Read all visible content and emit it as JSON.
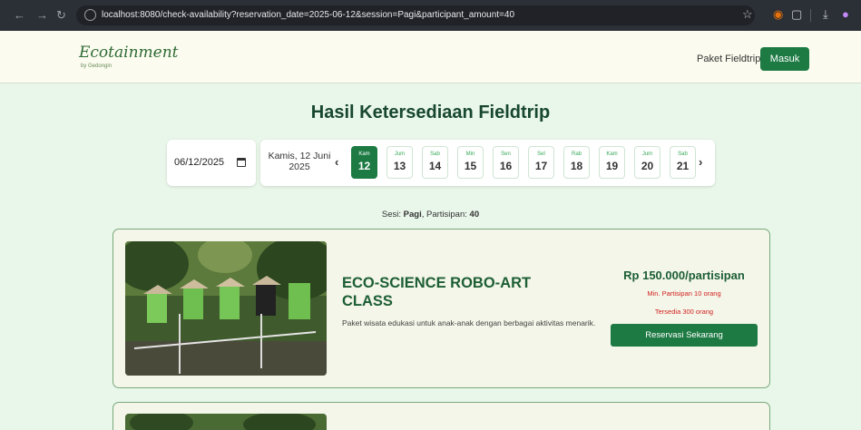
{
  "browser": {
    "url": "localhost:8080/check-availability?reservation_date=2025-06-12&session=Pagi&participant_amount=40"
  },
  "header": {
    "logo": "Ecotainment",
    "logo_sub": "by Gedongin",
    "nav_link": "Paket Fieldtrip",
    "login": "Masuk",
    "bg_color": "#fbfcef",
    "accent_color": "#1d7a43"
  },
  "page": {
    "title": "Hasil Ketersediaan Fieldtrip",
    "date_input_value": "06/12/2025",
    "current_date_line1": "Kamis, 12 Juni",
    "current_date_line2": "2025",
    "prev_icon": "chevron-left-icon",
    "next_icon": "chevron-right-icon",
    "days": [
      {
        "name": "Kam",
        "date": "12",
        "active": true
      },
      {
        "name": "Jum",
        "date": "13"
      },
      {
        "name": "Sab",
        "date": "14"
      },
      {
        "name": "Min",
        "date": "15"
      },
      {
        "name": "Sen",
        "date": "16"
      },
      {
        "name": "Sel",
        "date": "17"
      },
      {
        "name": "Rab",
        "date": "18"
      },
      {
        "name": "Kam",
        "date": "19"
      },
      {
        "name": "Jum",
        "date": "20"
      },
      {
        "name": "Sab",
        "date": "21"
      }
    ],
    "summary": {
      "session_label": "Sesi:",
      "session_value": "Pagi",
      "participant_label": "Partisipan:",
      "participant_value": "40"
    }
  },
  "packages": [
    {
      "title": "ECO-SCIENCE ROBO-ART CLASS",
      "description": "Paket wisata edukasi untuk anak-anak dengan berbagai aktivitas menarik.",
      "price": "Rp 150.000/partisipan",
      "min_participants": "Min. Partisipan 10 orang",
      "available": "Tersedia 300 orang",
      "cta": "Reservasi Sekarang"
    }
  ]
}
